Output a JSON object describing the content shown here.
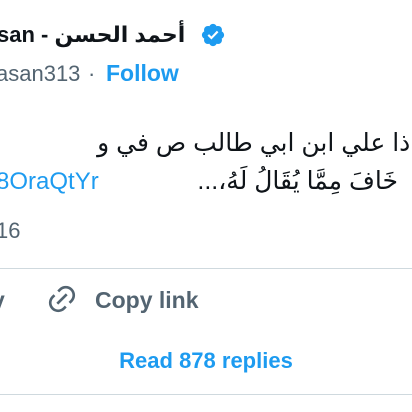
{
  "author": {
    "display_name": "أحمد الحسن - Ahmed Alhasan",
    "visible_name": "san - أحمد الحسن",
    "handle": "asan313",
    "separator": "·",
    "follow_label": "Follow",
    "verified_icon": "verified-badge-icon"
  },
  "tweet": {
    "line1": "لماذا علي ابن ابي طالب ص في و",
    "line2": "خَافَ مِمَّا يُقَالُ لَهُ،...",
    "link": "8OraQtYr",
    "time_fragment": "16"
  },
  "actions": {
    "reply_fragment": "y",
    "copy_link_label": "Copy link",
    "copy_link_icon": "link-icon",
    "read_replies_label": "Read 878 replies"
  },
  "colors": {
    "accent": "#1d9bf0",
    "text": "#0f1419",
    "secondary": "#536471",
    "divider": "#cfd9de"
  }
}
